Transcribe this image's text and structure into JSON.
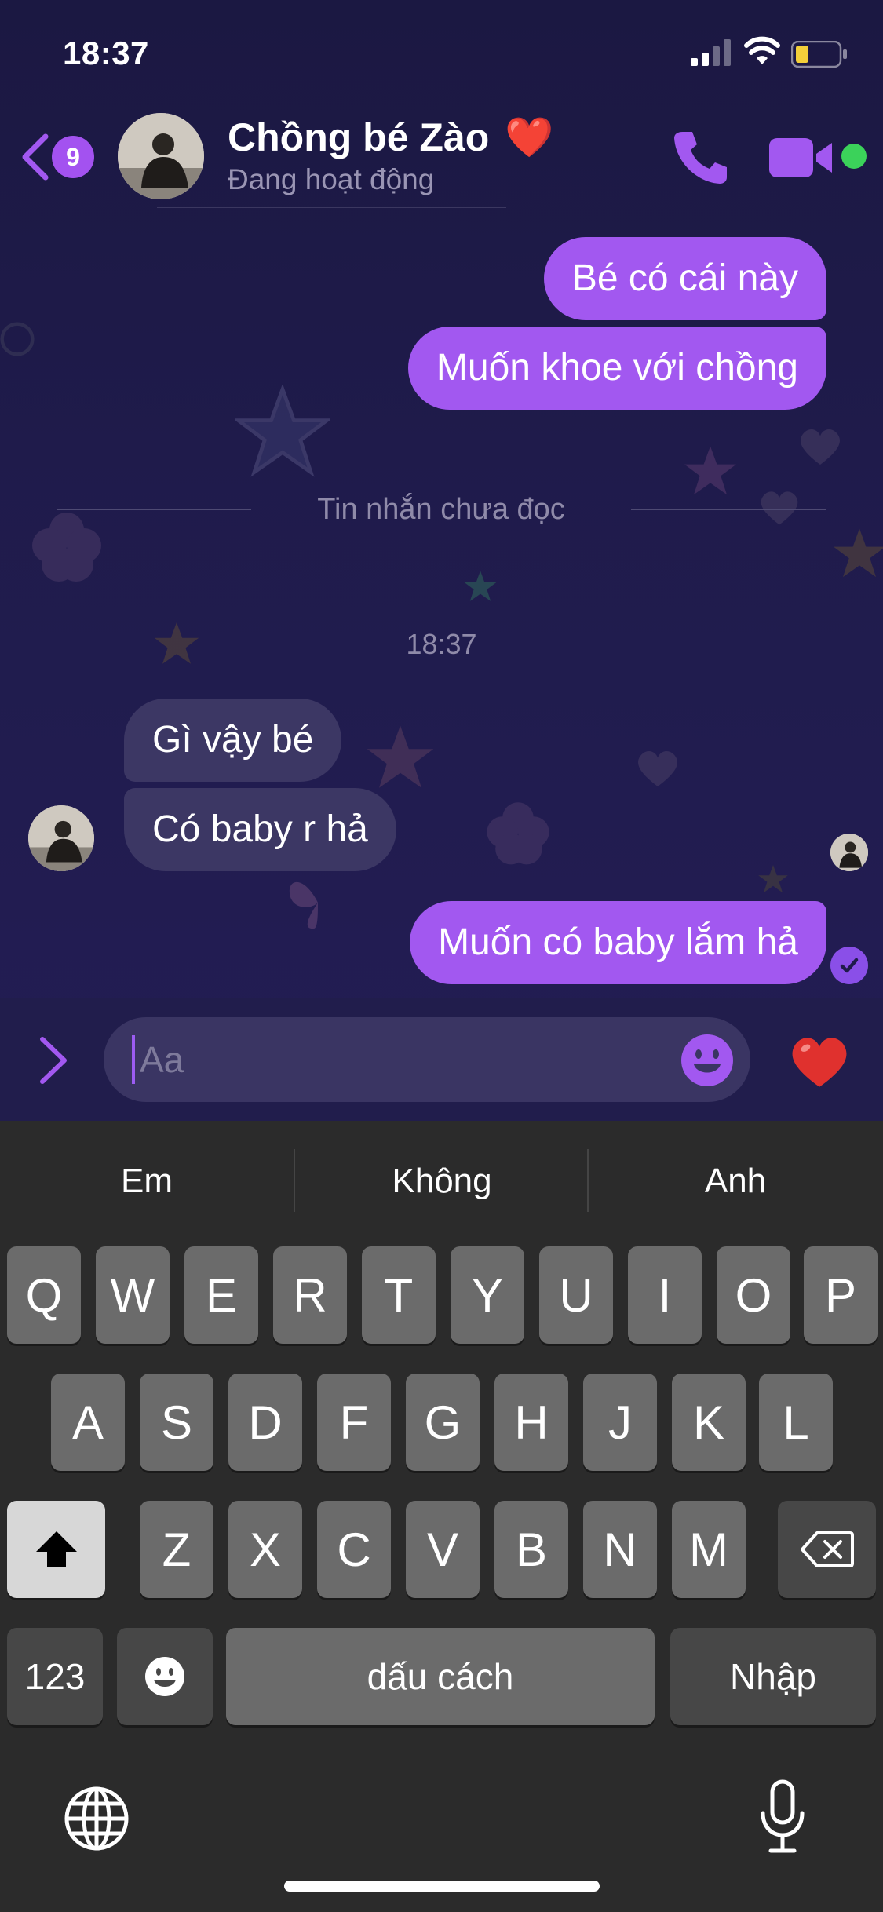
{
  "status_bar": {
    "time": "18:37"
  },
  "header": {
    "unread_count": "9",
    "contact_name": "Chồng bé Zào",
    "contact_heart": "❤️",
    "contact_status": "Đang hoạt động"
  },
  "messages": {
    "out_1": "Bé có cái này",
    "out_2": "Muốn khoe với chồng",
    "unread_divider": "Tin nhắn chưa đọc",
    "timestamp": "18:37",
    "in_1": "Gì vậy bé",
    "in_2": "Có baby r hả",
    "out_3": "Muốn có baby lắm hả"
  },
  "composer": {
    "placeholder": "Aa",
    "heart": "❤️"
  },
  "keyboard": {
    "suggestions": [
      "Em",
      "Không",
      "Anh"
    ],
    "row1": [
      "Q",
      "W",
      "E",
      "R",
      "T",
      "Y",
      "U",
      "I",
      "O",
      "P"
    ],
    "row2": [
      "A",
      "S",
      "D",
      "F",
      "G",
      "H",
      "J",
      "K",
      "L"
    ],
    "row3": [
      "Z",
      "X",
      "C",
      "V",
      "B",
      "N",
      "M"
    ],
    "numbers_label": "123",
    "space_label": "dấu cách",
    "return_label": "Nhập"
  },
  "colors": {
    "accent": "#a258f0",
    "chat_background": "#1c1942",
    "incoming_bubble": "#3c3764",
    "online": "#3bd25a",
    "keyboard": "#2b2b2b"
  }
}
